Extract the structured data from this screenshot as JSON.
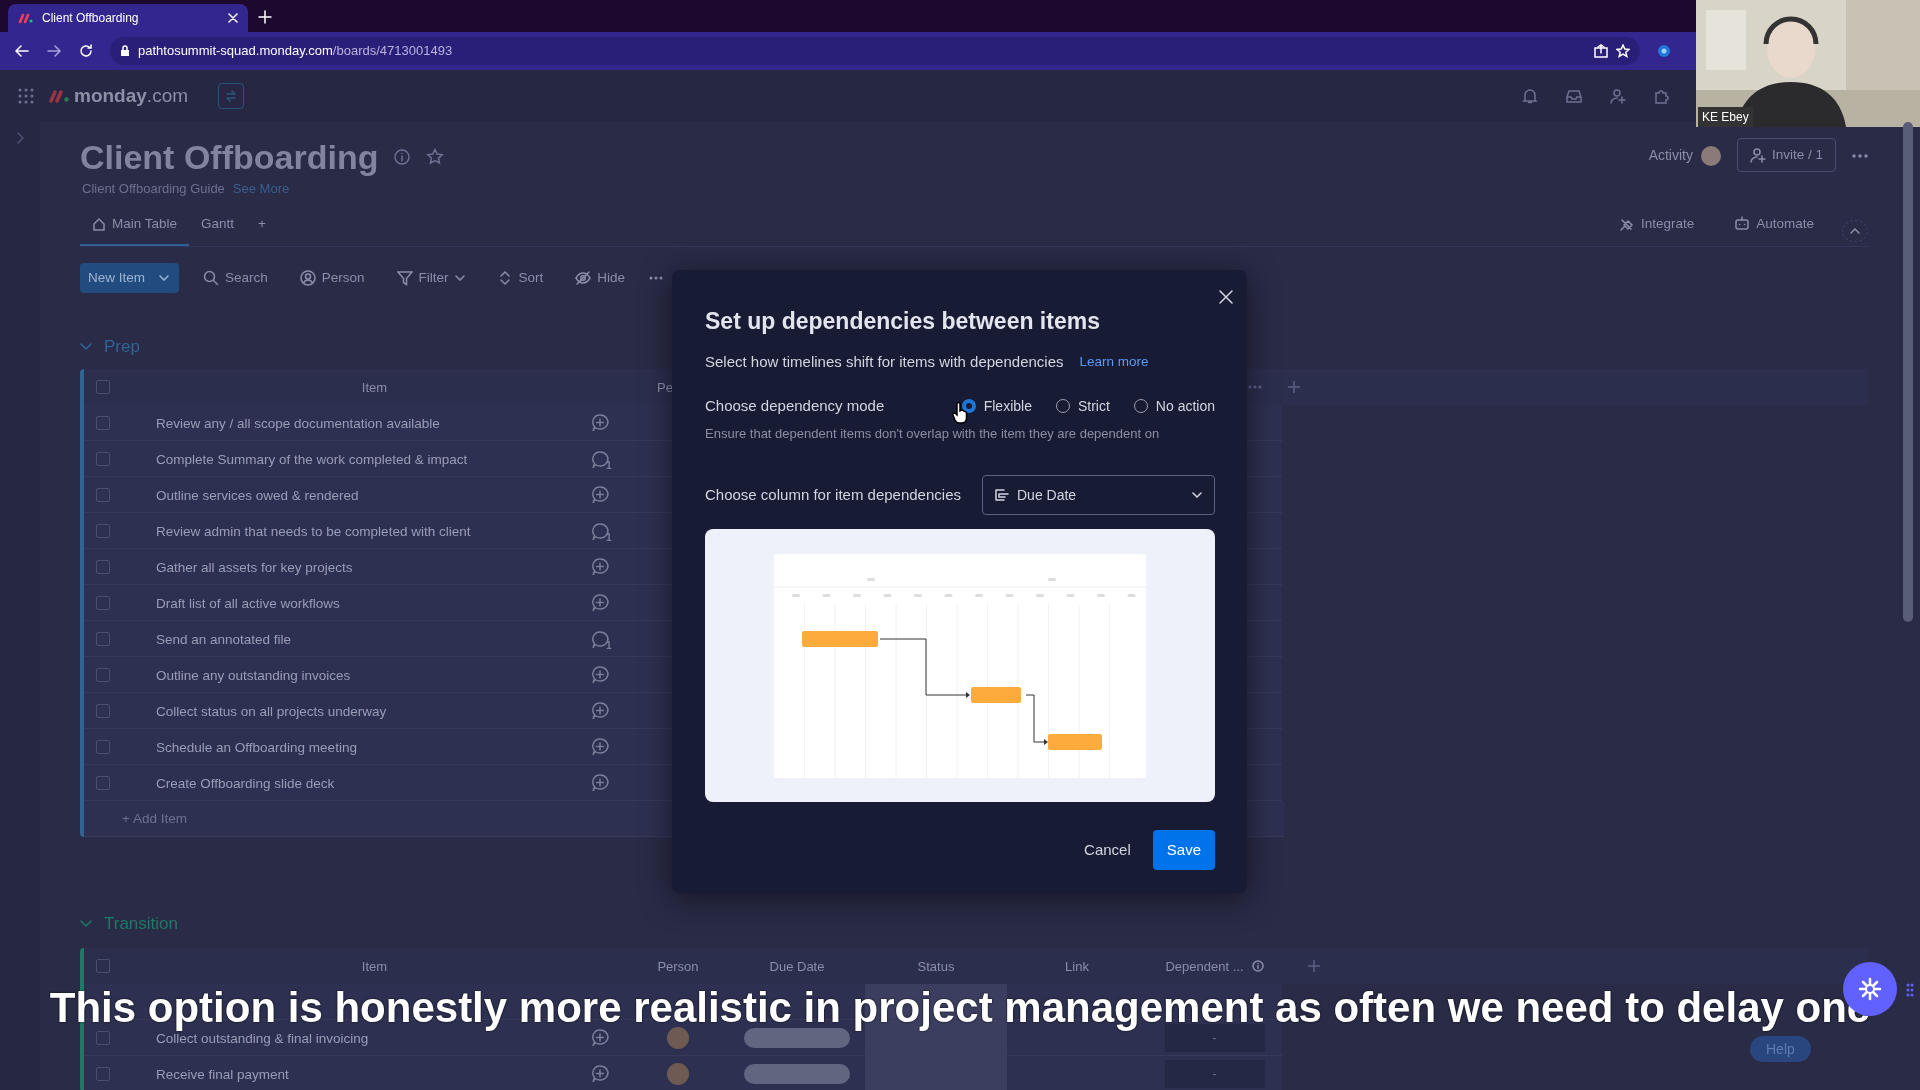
{
  "browser": {
    "tab": {
      "title": "Client Offboarding",
      "selected": true
    },
    "url_domain": "pathtosummit-squad.monday.com",
    "url_path": "/boards/4713001493"
  },
  "webcam": {
    "kind": "picture",
    "label": "KE Ebey"
  },
  "app_bar": {
    "logo": "**monday**.com"
  },
  "board": {
    "title": "Client Offboarding",
    "description": "Client Offboarding Guide",
    "see_more": "See More",
    "activity": "Activity",
    "invite": "Invite / 1"
  },
  "views": [
    {
      "label": "Main Table",
      "selected": true
    },
    {
      "label": "Gantt",
      "selected": false
    }
  ],
  "add_view": "+",
  "view_actions": [
    {
      "label": "Integrate",
      "kind": "integrate"
    },
    {
      "label": "Automate",
      "kind": "automate"
    }
  ],
  "toolbar": {
    "new_item": "New Item",
    "tools": [
      {
        "label": "Search",
        "kind": "search"
      },
      {
        "label": "Person",
        "kind": "person"
      },
      {
        "label": "Filter",
        "kind": "filter"
      },
      {
        "label": "Sort",
        "kind": "sort"
      },
      {
        "label": "Hide",
        "kind": "hide"
      }
    ]
  },
  "groups": [
    {
      "name": "Prep",
      "color": "#2e6496",
      "all_checked": false,
      "columns": [
        "Item",
        "Pe"
      ],
      "rows": [
        {
          "item": "Review any / all scope documentation available",
          "checked": false
        },
        {
          "item": "Complete Summary of the work completed & impact",
          "updates": "1",
          "checked": false
        },
        {
          "item": "Outline services owed & rendered",
          "checked": false
        },
        {
          "item": "Review admin that needs to be completed with client",
          "updates": "1",
          "checked": false
        },
        {
          "item": "Gather all assets for key projects",
          "checked": false
        },
        {
          "item": "Draft list of all active workflows",
          "checked": false
        },
        {
          "item": "Send an annotated file",
          "updates": "1",
          "checked": false
        },
        {
          "item": "Outline any outstanding invoices",
          "checked": false
        },
        {
          "item": "Collect status on all projects underway",
          "checked": false
        },
        {
          "item": "Schedule an Offboarding meeting",
          "checked": false
        },
        {
          "item": "Create Offboarding slide deck",
          "checked": false
        }
      ],
      "add_item": "+ Add Item"
    },
    {
      "name": "Transition",
      "color": "#1f7a64",
      "all_checked": false,
      "columns": [
        "Item",
        "Person",
        "Due Date",
        "Status",
        "Link",
        "Dependent ..."
      ],
      "rows": [
        {
          "kind": "covered"
        },
        {
          "kind": "item",
          "item": "Collect outstanding & final invoicing",
          "dependent": "-",
          "checked": false
        },
        {
          "kind": "item",
          "item": "Receive final payment",
          "dependent": "-",
          "checked": false
        }
      ]
    }
  ],
  "modal": {
    "title": "Set up dependencies between items",
    "subtitle": "Select how timelines shift for items with dependencies",
    "link": "Learn more",
    "mode_label": "Choose dependency mode",
    "modes": [
      {
        "label": "Flexible",
        "selected": true
      },
      {
        "label": "Strict",
        "selected": false
      },
      {
        "label": "No action",
        "selected": false
      }
    ],
    "mode_hint": "Ensure that dependent items don't overlap with the item they are dependent on",
    "column_label": "Choose column for item dependencies",
    "column_value": "Due Date",
    "buttons": [
      {
        "label": "Cancel",
        "kind": "secondary"
      },
      {
        "label": "Save",
        "kind": "primary"
      }
    ]
  },
  "caption": "This option is honestly more realistic in project management as often we need to delay one",
  "help": "Help"
}
